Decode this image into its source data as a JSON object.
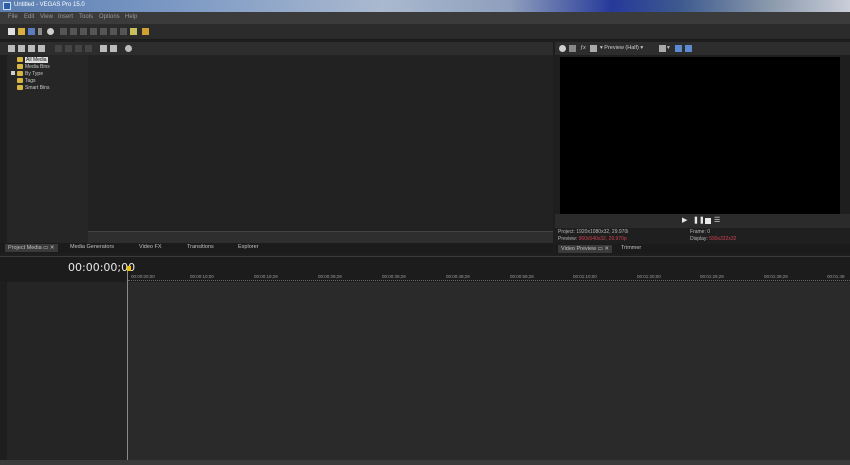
{
  "window": {
    "title": "Untitled - VEGAS Pro 15.0"
  },
  "menu": [
    "File",
    "Edit",
    "View",
    "Insert",
    "Tools",
    "Options",
    "Help"
  ],
  "project_media": {
    "tree": [
      {
        "label": "All Media",
        "selected": true
      },
      {
        "label": "Media Bins"
      },
      {
        "label": "By Type",
        "expandable": true
      },
      {
        "label": "Tags"
      },
      {
        "label": "Smart Bins"
      }
    ]
  },
  "dock_tabs": [
    "Project Media",
    "Media Generators",
    "Video FX",
    "Transitions",
    "Explorer"
  ],
  "video_preview": {
    "preview_label": "Preview (Half)",
    "project_label": "Project:",
    "project_value": "1920x1080x32, 29.970i",
    "preview_info_label": "Preview:",
    "preview_info_value": "960x540x32, 29.970p",
    "frame_label": "Frame:",
    "frame_value": "0",
    "display_label": "Display:",
    "display_value": "590x332x32",
    "tabs": [
      "Video Preview",
      "Trimmer"
    ]
  },
  "timeline": {
    "timecode": "00:00:00;00",
    "ruler_ticks": [
      "00:00:00;00",
      "00:00:10;00",
      "00:00:19;29",
      "00:00:29;29",
      "00:00:39;29",
      "00:00:49;29",
      "00:00:59;28",
      "00:01:10;00",
      "00:01:20;00",
      "00:01:29;29",
      "00:01:39;29",
      "00:01:49"
    ]
  },
  "colors": {
    "accent_red": "#d04050",
    "folder": "#d7b642",
    "cursor": "#e8c000"
  }
}
